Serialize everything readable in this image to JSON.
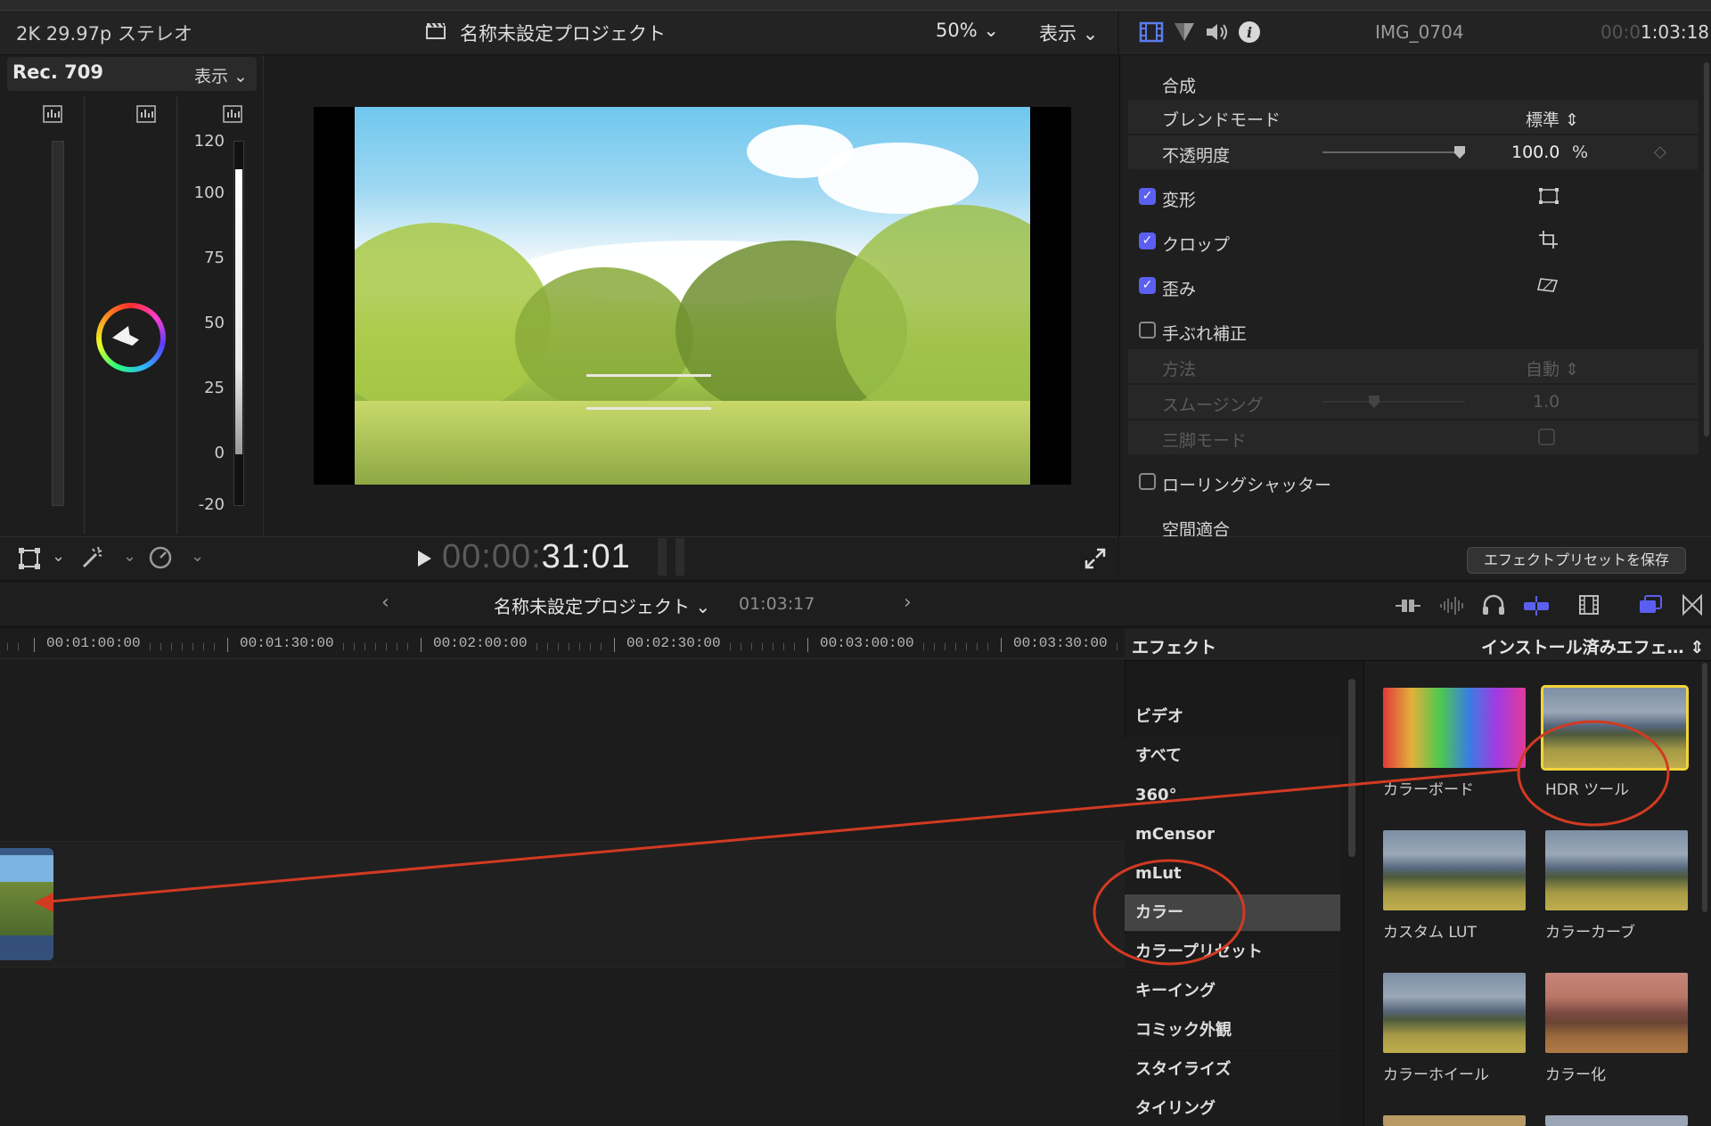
{
  "viewer": {
    "format": "2K 29.97p ステレオ",
    "project_title": "名称未設定プロジェクト",
    "zoom": "50%",
    "view_menu": "表示",
    "timecode_dim": "00:00:",
    "timecode_lit": "31:01"
  },
  "scopes": {
    "standard": "Rec. 709",
    "view_menu": "表示",
    "ticks": [
      "120",
      "100",
      "75",
      "50",
      "25",
      "0",
      "-20"
    ]
  },
  "inspector": {
    "clip_name": "IMG_0704",
    "timecode_dim": "00:0",
    "timecode_lit": "1:03:18",
    "compositing": "合成",
    "blend_mode_label": "ブレンドモード",
    "blend_mode_value": "標準",
    "opacity_label": "不透明度",
    "opacity_value": "100.0",
    "opacity_unit": "%",
    "opacity_level": 1.0,
    "transform": "変形",
    "crop": "クロップ",
    "distort": "歪み",
    "stabilization": "手ぶれ補正",
    "method_label": "方法",
    "method_value": "自動",
    "smoothing_label": "スムージング",
    "smoothing_value": "1.0",
    "tripod_label": "三脚モード",
    "rolling_shutter": "ローリングシャッター",
    "spatial_conform": "空間適合",
    "save_preset": "エフェクトプリセットを保存"
  },
  "timeline": {
    "project_title": "名称未設定プロジェクト",
    "duration": "01:03:17",
    "ruler": [
      "00:01:00:00",
      "00:01:30:00",
      "00:02:00:00",
      "00:02:30:00",
      "00:03:00:00",
      "00:03:30:00"
    ]
  },
  "effects": {
    "header": "エフェクト",
    "installed": "インストール済みエフェ…",
    "section_video": "ビデオ",
    "categories": [
      "すべて",
      "360°",
      "mCensor",
      "mLut",
      "カラー",
      "カラープリセット",
      "キーイング",
      "コミック外観",
      "スタイライズ",
      "タイリング"
    ],
    "selected_category": "カラー",
    "items": [
      "カラーボード",
      "HDR ツール",
      "カスタム LUT",
      "カラーカーブ",
      "カラーホイール",
      "カラー化"
    ]
  },
  "colors": {
    "accent": "#5b5ff0",
    "annotation": "#d23a22",
    "selection": "#f2d43a"
  }
}
